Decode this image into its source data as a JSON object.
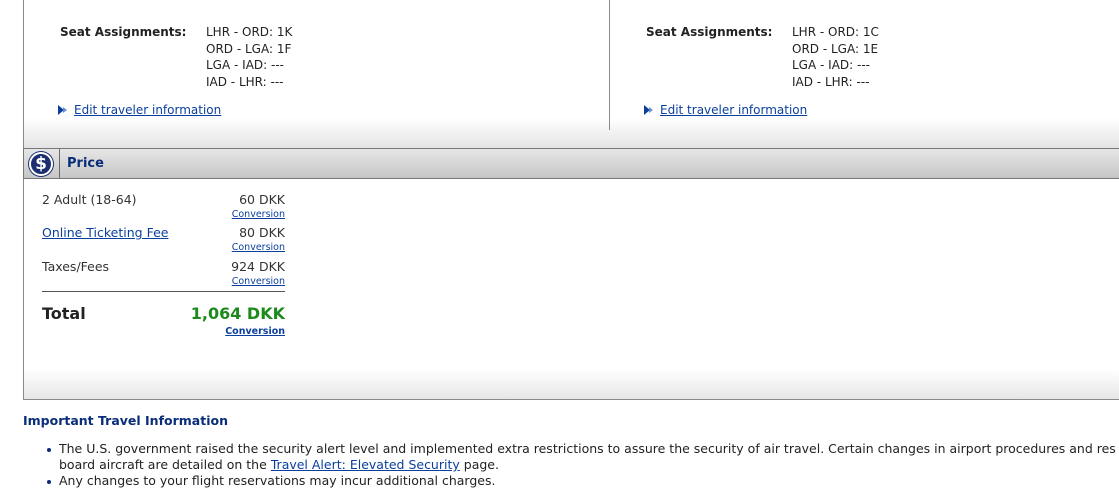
{
  "travelers": [
    {
      "seat_label": "Seat Assignments:",
      "seats": [
        "LHR - ORD: 1K",
        "ORD - LGA: 1F",
        "LGA - IAD: ---",
        "IAD - LHR: ---"
      ],
      "edit_link": "Edit traveler information"
    },
    {
      "seat_label": "Seat Assignments:",
      "seats": [
        "LHR - ORD: 1C",
        "ORD - LGA: 1E",
        "LGA - IAD: ---",
        "IAD - LHR: ---"
      ],
      "edit_link": "Edit traveler information"
    }
  ],
  "price": {
    "title": "Price",
    "icon": "dollar-icon",
    "rows": [
      {
        "label": "2 Adult (18-64)",
        "amount": "60 DKK",
        "conversion": "Conversion"
      },
      {
        "label": "Online Ticketing Fee",
        "amount": "80 DKK",
        "conversion": "Conversion"
      },
      {
        "label": "Taxes/Fees",
        "amount": "924 DKK",
        "conversion": "Conversion"
      }
    ],
    "total_label": "Total",
    "total_amount": "1,064 DKK",
    "total_conversion": "Conversion"
  },
  "important_info": {
    "title": "Important Travel Information",
    "item1_before": "The U.S. government raised the security alert level and implemented extra restrictions to assure the security of air travel. Certain changes in airport procedures and res",
    "item1_line2_before": "board aircraft are detailed on the ",
    "item1_link": "Travel Alert: Elevated Security",
    "item1_after": " page.",
    "item2": "Any changes to your flight reservations may incur additional charges."
  },
  "colors": {
    "link": "#0a3f9e",
    "heading": "#0a2d7a",
    "total_green": "#1c8a1c",
    "bar_gray": "#c6c6c6"
  }
}
